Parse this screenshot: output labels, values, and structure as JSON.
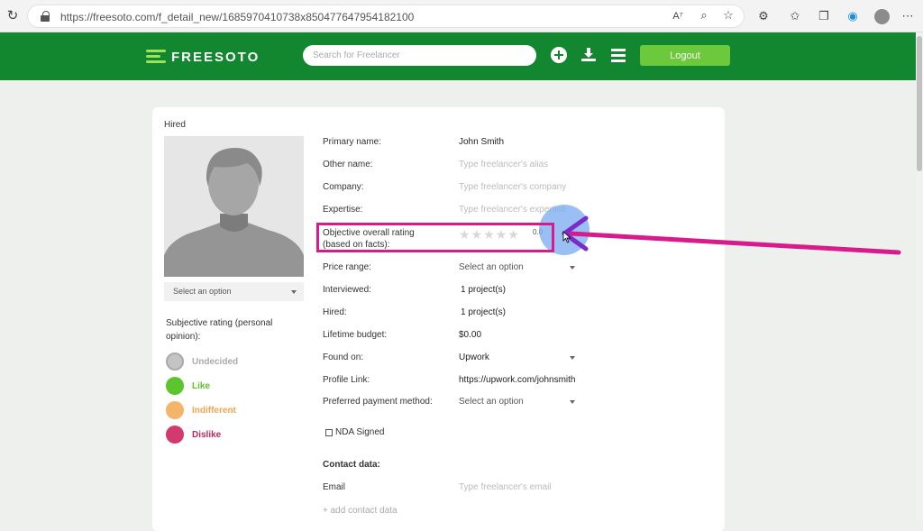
{
  "browser": {
    "url": "https://freesoto.com/f_detail_new/1685970410738x850477647954182100"
  },
  "header": {
    "logo_text": "FREESOTO",
    "search_placeholder": "Search for Freelancer",
    "logout_label": "Logout"
  },
  "profile": {
    "status": "Hired",
    "status_select": "Select an option",
    "subjective_label": "Subjective rating (personal opinion):",
    "ratings": [
      {
        "label": "Undecided",
        "color": "#c4c4c4"
      },
      {
        "label": "Like",
        "color": "#5cc42c"
      },
      {
        "label": "Indifferent",
        "color": "#f4b46a"
      },
      {
        "label": "Dislike",
        "color": "#d23a6d"
      }
    ]
  },
  "fields": {
    "primary_name": {
      "label": "Primary name:",
      "value": "John Smith"
    },
    "other_name": {
      "label": "Other name:",
      "placeholder": "Type freelancer's alias"
    },
    "company": {
      "label": "Company:",
      "placeholder": "Type freelancer's company"
    },
    "expertise": {
      "label": "Expertise:",
      "placeholder": "Type freelancer's expertise"
    },
    "objective_rating": {
      "label_line1": "Objective overall rating",
      "label_line2": "(based on facts):",
      "stars": "★★★★★",
      "value": "0.0",
      "rating": 0
    },
    "price_range": {
      "label": "Price range:",
      "value": "Select an option"
    },
    "interviewed": {
      "label": "Interviewed:",
      "value": "1 project(s)"
    },
    "hired": {
      "label": "Hired:",
      "value": "1 project(s)"
    },
    "lifetime_budget": {
      "label": "Lifetime budget:",
      "value": "$0.00"
    },
    "found_on": {
      "label": "Found on:",
      "value": "Upwork"
    },
    "profile_link": {
      "label": "Profile Link:",
      "value": "https://upwork.com/johnsmith"
    },
    "payment_method": {
      "label": "Preferred payment method:",
      "value": "Select an option"
    },
    "nda": {
      "label": "NDA Signed",
      "checked": false
    },
    "contact_heading": "Contact data:",
    "email": {
      "label": "Email",
      "placeholder": "Type freelancer's email"
    },
    "add_contact": "+ add contact data"
  },
  "colors": {
    "brand_green": "#13872f",
    "button_green": "#6cc93c",
    "highlight": "#d81b8c"
  }
}
